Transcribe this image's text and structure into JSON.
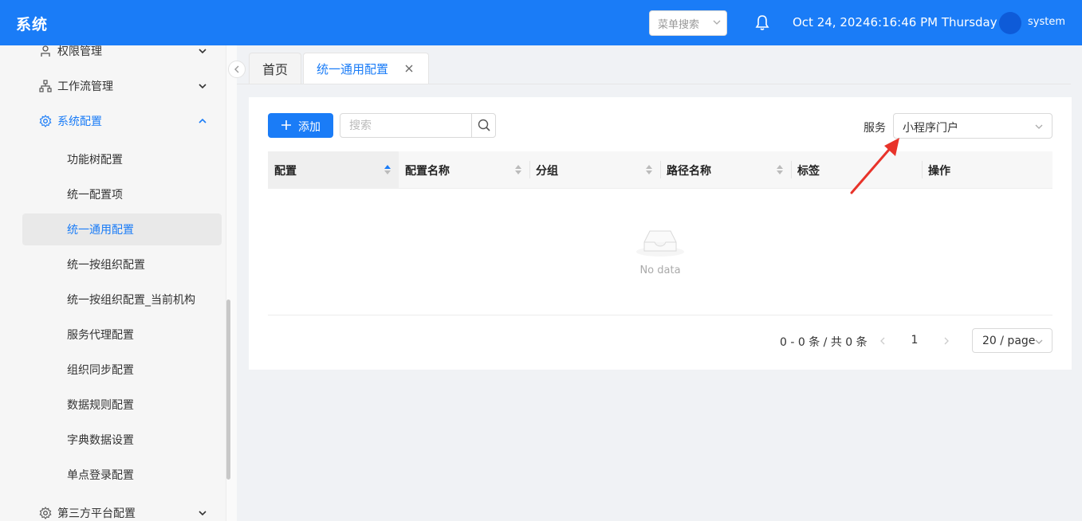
{
  "header": {
    "app_title": "系统",
    "menu_search_placeholder": "菜单搜索",
    "datetime": "Oct 24, 20246:16:46 PM Thursday",
    "username": "system"
  },
  "sidebar": {
    "groups": [
      {
        "label": "权限管理",
        "expanded": false,
        "icon": "user-icon"
      },
      {
        "label": "工作流管理",
        "expanded": false,
        "icon": "org-chart-icon"
      },
      {
        "label": "系统配置",
        "expanded": true,
        "icon": "gear-icon"
      },
      {
        "label": "第三方平台配置",
        "expanded": false,
        "icon": "gear-icon"
      }
    ],
    "items": [
      {
        "label": "功能树配置"
      },
      {
        "label": "统一配置项"
      },
      {
        "label": "统一通用配置",
        "selected": true
      },
      {
        "label": "统一按组织配置"
      },
      {
        "label": "统一按组织配置_当前机构"
      },
      {
        "label": "服务代理配置"
      },
      {
        "label": "组织同步配置"
      },
      {
        "label": "数据规则配置"
      },
      {
        "label": "字典数据设置"
      },
      {
        "label": "单点登录配置"
      }
    ]
  },
  "tabs": [
    {
      "label": "首页"
    },
    {
      "label": "统一通用配置",
      "active": true
    }
  ],
  "toolbar": {
    "add_label": "添加",
    "search_placeholder": "搜索",
    "service_label": "服务",
    "service_value": "小程序门户"
  },
  "table": {
    "columns": [
      "配置",
      "配置名称",
      "分组",
      "路径名称",
      "标签",
      "操作"
    ],
    "empty_text": "No data"
  },
  "pagination": {
    "total_text": "0 - 0 条 / 共 0 条",
    "current_page": "1",
    "page_size": "20 / page"
  },
  "colors": {
    "primary": "#1a7cf7",
    "annotation_arrow": "#e8332a"
  }
}
